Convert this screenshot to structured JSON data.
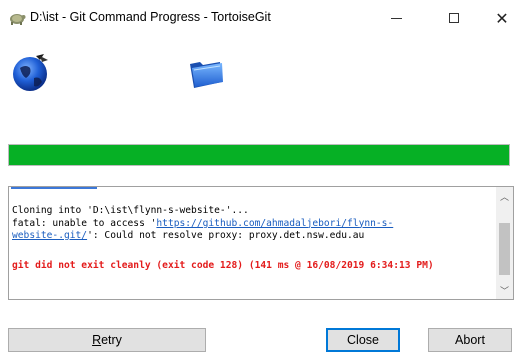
{
  "window": {
    "title": "D:\\ist - Git Command Progress - TortoiseGit"
  },
  "progress": {
    "percent": 100,
    "color": "#06b025"
  },
  "log": {
    "line1": "Cloning into 'D:\\ist\\flynn-s-website-'...",
    "line2_prefix": "fatal: unable to access '",
    "line2_link": "https://github.com/ahmadaljebori/flynn-s-",
    "line3_link": "website-.git/",
    "line3_suffix": "': Could not resolve proxy: proxy.det.nsw.edu.au",
    "error_line": "git did not exit cleanly (exit code 128) (141 ms @ 16/08/2019 6:34:13 PM)",
    "link_color": "#1a5dbf",
    "error_color": "#e31b1b"
  },
  "buttons": {
    "retry_first": "R",
    "retry_rest": "etry",
    "close": "Close",
    "abort": "Abort"
  },
  "icons": {
    "app": "tortoisegit-icon",
    "globe": "globe-icon",
    "folder": "folder-icon"
  }
}
